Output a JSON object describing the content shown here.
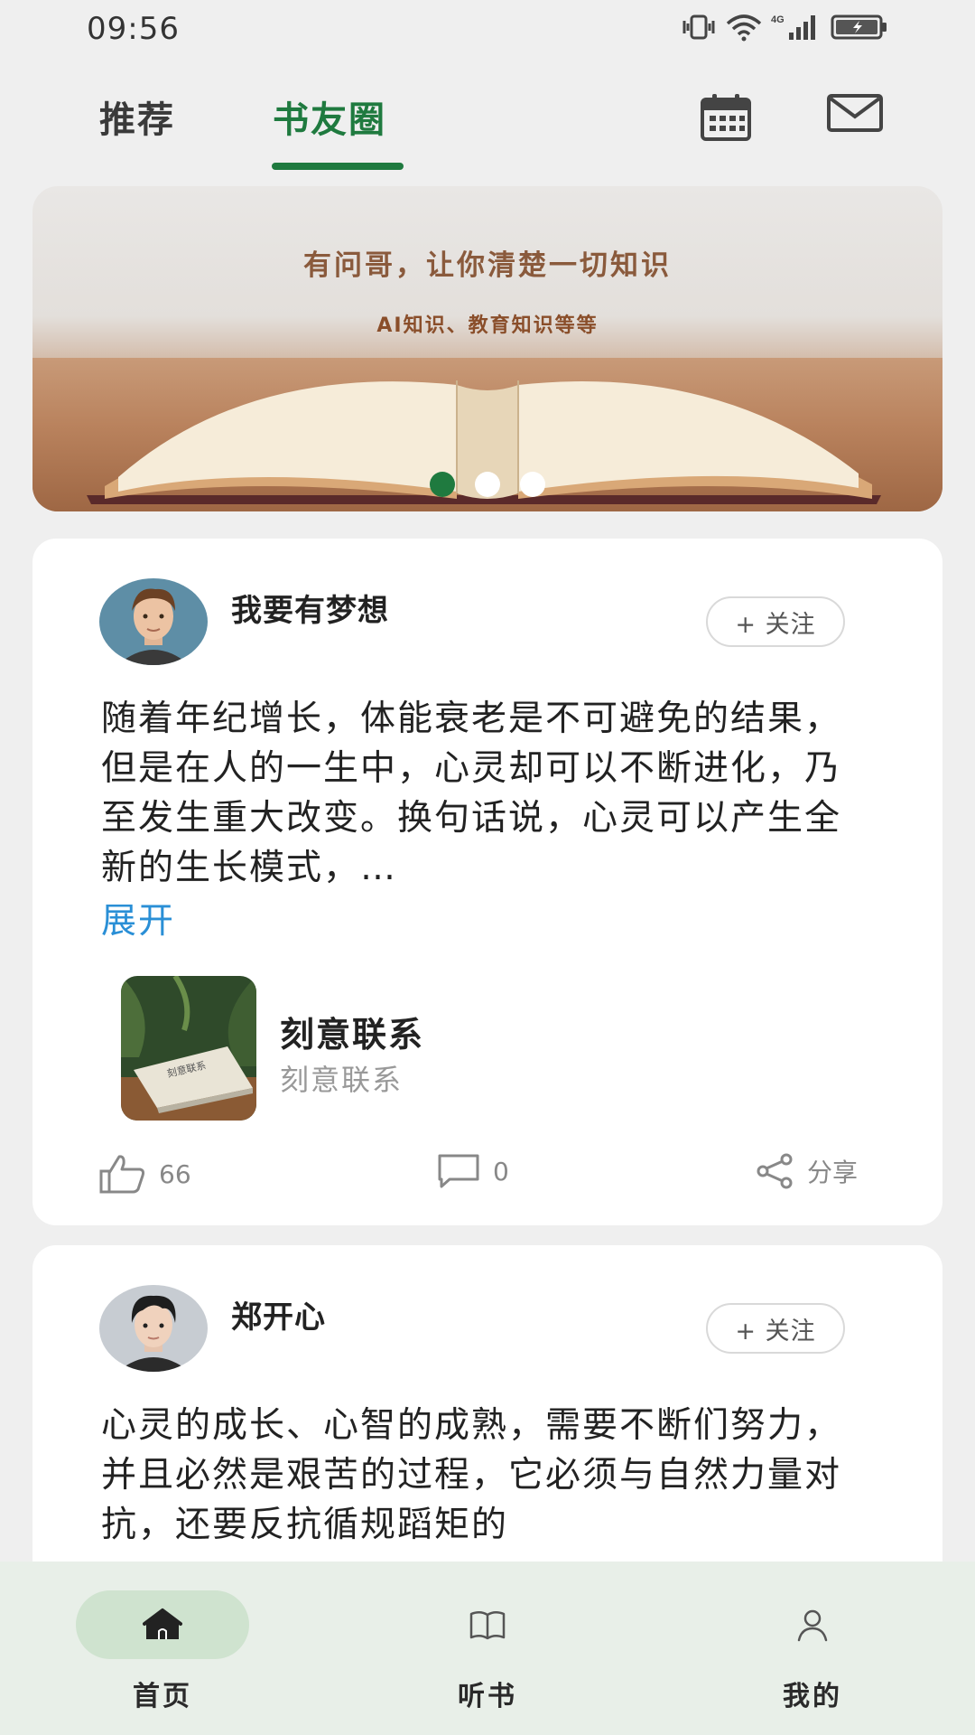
{
  "status_bar": {
    "time": "09:56",
    "icons": [
      "vibrate-icon",
      "wifi-icon",
      "cellular-4g-icon",
      "battery-charging-icon"
    ],
    "network_label": "4G"
  },
  "header": {
    "tabs": [
      {
        "label": "推荐",
        "active": false
      },
      {
        "label": "书友圈",
        "active": true
      }
    ],
    "icons": [
      "calendar-icon",
      "mail-icon"
    ],
    "accent_color": "#1f7a3f"
  },
  "banner": {
    "title": "有问哥，让你清楚一切知识",
    "subtitle": "AI知识、教育知识等等",
    "pages": 3,
    "active_page": 1
  },
  "posts": [
    {
      "username": "我要有梦想",
      "follow_label": "+ 关注",
      "text": "随着年纪增长，体能衰老是不可避免的结果，但是在人的一生中，心灵却可以不断进化，乃至发生重大改变。换句话说，心灵可以产生全新的生长模式，…",
      "expand_label": "展开",
      "book": {
        "title": "刻意联系",
        "subtitle": "刻意联系",
        "cover_text": "刻意联系"
      },
      "likes": "66",
      "comments": "0",
      "share_label": "分享"
    },
    {
      "username": "郑开心",
      "follow_label": "+ 关注",
      "text": "心灵的成长、心智的成熟，需要不断们努力，并且必然是艰苦的过程，它必须与自然力量对抗，还要反抗循规蹈矩的"
    }
  ],
  "bottom_nav": [
    {
      "label": "首页",
      "icon": "home-icon",
      "active": true
    },
    {
      "label": "听书",
      "icon": "book-icon",
      "active": false
    },
    {
      "label": "我的",
      "icon": "person-icon",
      "active": false
    }
  ]
}
